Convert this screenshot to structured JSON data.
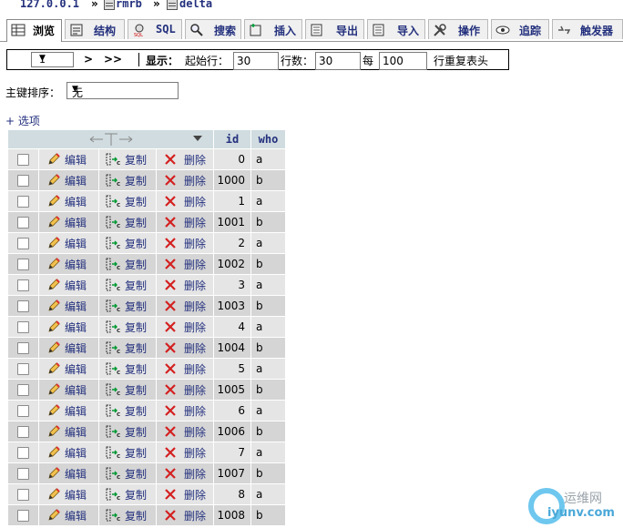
{
  "breadcrumb": {
    "server": "127.0.0.1",
    "database": "rmrb",
    "table": "delta",
    "separator": "»"
  },
  "tabs": [
    {
      "label": "浏览",
      "active": true
    },
    {
      "label": "结构"
    },
    {
      "label": "SQL"
    },
    {
      "label": "搜索"
    },
    {
      "label": "插入"
    },
    {
      "label": "导出"
    },
    {
      "label": "导入"
    },
    {
      "label": "操作"
    },
    {
      "label": "追踪"
    },
    {
      "label": "触发器"
    }
  ],
  "nav": {
    "page_value": "1",
    "next_label": ">",
    "last_label": ">>",
    "show_label": "显示：",
    "start_row_label": "起始行：",
    "start_row_value": "30",
    "row_count_label": "行数：",
    "row_count_value": "30",
    "every_label": "每",
    "repeat_value": "100",
    "repeat_header_label": "行重复表头"
  },
  "primary_key": {
    "label": "主键排序：",
    "value": "无"
  },
  "options_link": "+ 选项",
  "table": {
    "columns": [
      "id",
      "who"
    ],
    "actions": {
      "edit": "编辑",
      "copy": "复制",
      "delete": "删除"
    },
    "rows": [
      {
        "id": "0",
        "who": "a"
      },
      {
        "id": "1000",
        "who": "b"
      },
      {
        "id": "1",
        "who": "a"
      },
      {
        "id": "1001",
        "who": "b"
      },
      {
        "id": "2",
        "who": "a"
      },
      {
        "id": "1002",
        "who": "b"
      },
      {
        "id": "3",
        "who": "a"
      },
      {
        "id": "1003",
        "who": "b"
      },
      {
        "id": "4",
        "who": "a"
      },
      {
        "id": "1004",
        "who": "b"
      },
      {
        "id": "5",
        "who": "a"
      },
      {
        "id": "1005",
        "who": "b"
      },
      {
        "id": "6",
        "who": "a"
      },
      {
        "id": "1006",
        "who": "b"
      },
      {
        "id": "7",
        "who": "a"
      },
      {
        "id": "1007",
        "who": "b"
      },
      {
        "id": "8",
        "who": "a"
      },
      {
        "id": "1008",
        "who": "b"
      }
    ]
  },
  "watermark": {
    "text_cn": "运维网",
    "url": "iyunv.com"
  },
  "colors": {
    "link": "#23307d",
    "header_bg": "#d0dce0",
    "row_odd": "#e5e5e5",
    "row_even": "#d5d5d5",
    "delete_icon": "#d42020"
  }
}
